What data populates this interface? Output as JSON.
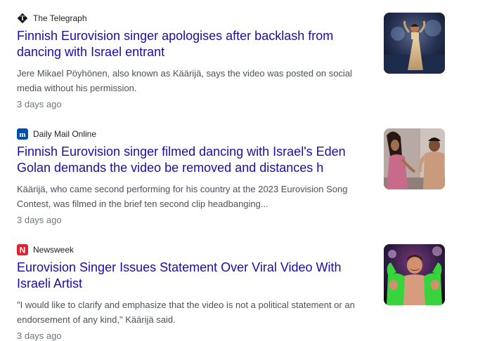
{
  "articles": [
    {
      "source": {
        "name": "The Telegraph",
        "icon": "telegraph-logo-icon"
      },
      "headline_lines": [
        "Finnish Eurovision singer apologises after backlash from",
        "dancing with Israel entrant"
      ],
      "snippet_lines": [
        "Jere Mikael Pöyhönen, also known as Käärijä, says the video was posted on social",
        "media without his permission."
      ],
      "time": "3 days ago",
      "thumbnail": "stage-performer-gold-dress"
    },
    {
      "source": {
        "name": "Daily Mail Online",
        "icon": "daily-mail-logo-icon"
      },
      "headline_lines": [
        "Finnish Eurovision singer filmed dancing with Israel's Eden",
        "Golan demands the video be removed and distances h"
      ],
      "snippet_lines": [
        "Käärijä, who came second performing for his country at the 2023 Eurovision Song",
        "Contest, was filmed in the brief ten second clip headbanging..."
      ],
      "time": "3 days ago",
      "thumbnail": "two-people-dancing"
    },
    {
      "source": {
        "name": "Newsweek",
        "icon": "newsweek-logo-icon"
      },
      "headline_lines": [
        "Eurovision Singer Issues Statement Over Viral Video With",
        "Israeli Artist"
      ],
      "snippet_lines": [
        "\"I would like to clarify and emphasize that the video is not a political statement or an",
        "endorsement of any kind,\" Käärijä said."
      ],
      "time": "3 days ago",
      "thumbnail": "singer-green-bolero"
    }
  ],
  "colors": {
    "headline": "#1a0dab",
    "snippet": "#4d5156",
    "timestamp": "#70757a",
    "daily_mail": "#004db3",
    "newsweek": "#e4202e"
  }
}
